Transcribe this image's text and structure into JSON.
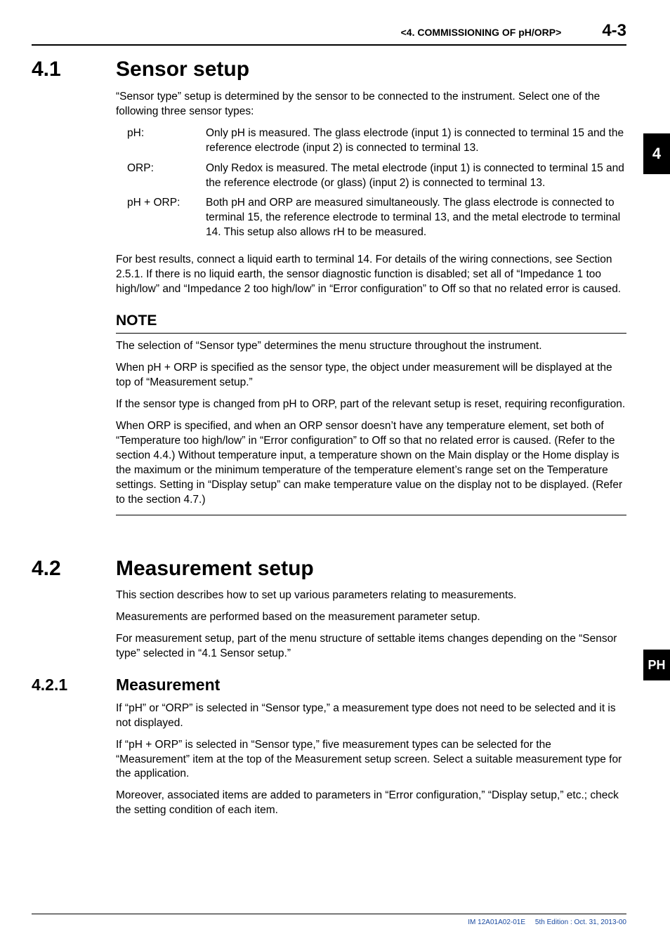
{
  "header": {
    "running": "<4.  COMMISSIONING OF pH/ORP>",
    "pagenum": "4-3"
  },
  "tabs": {
    "num": "4",
    "ph": "PH"
  },
  "s41": {
    "num": "4.1",
    "title": "Sensor setup",
    "intro": "“Sensor type” setup is determined by the sensor to be connected to the instrument. Select one of the following three sensor types:",
    "defs": {
      "k1": "pH:",
      "v1": "Only pH is measured. The glass electrode (input 1) is connected to terminal 15 and the reference electrode (input 2) is connected to terminal 13.",
      "k2": "ORP:",
      "v2": "Only Redox is measured. The metal electrode (input 1) is connected to terminal 15 and the reference electrode (or glass) (input 2) is connected to terminal 13.",
      "k3": "pH + ORP:",
      "v3": "Both pH and ORP are measured simultaneously. The glass electrode is connected to terminal 15, the reference electrode to terminal 13, and the metal electrode to terminal 14. This setup also allows rH to be measured."
    },
    "para2": "For best results, connect a liquid earth to terminal 14. For details of the wiring connections, see Section 2.5.1. If there is no liquid earth, the sensor diagnostic function is disabled; set all of “Impedance 1 too high/low” and “Impedance 2 too high/low” in “Error configuration” to Off so that no related error is caused."
  },
  "note": {
    "title": "NOTE",
    "p1": "The selection of “Sensor type” determines the menu structure throughout the instrument.",
    "p2": "When pH + ORP is specified as the sensor type, the object under measurement will be displayed at the top of “Measurement setup.”",
    "p3": "If the sensor type is changed from pH to ORP, part of the relevant setup is reset, requiring reconfiguration.",
    "p4": "When ORP is specified, and when an ORP sensor doesn’t have any temperature element, set both of “Temperature too high/low” in “Error configuration” to Off so that no related error is caused. (Refer to the section 4.4.) Without temperature input, a temperature shown on the Main display or the Home display is the maximum or the minimum temperature of the temperature element’s range set on the Temperature settings. Setting in “Display setup” can make temperature value on the display not to be displayed. (Refer to the section 4.7.)"
  },
  "s42": {
    "num": "4.2",
    "title": "Measurement setup",
    "p1": "This section describes how to set up various parameters relating to measurements.",
    "p2": "Measurements are performed based on the measurement parameter setup.",
    "p3": "For measurement setup, part of the menu structure of settable items changes depending on the “Sensor type” selected in “4.1 Sensor setup.”"
  },
  "s421": {
    "num": "4.2.1",
    "title": "Measurement",
    "p1": "If “pH” or “ORP” is selected in “Sensor type,” a measurement type does not need to be selected and it is not displayed.",
    "p2": "If “pH + ORP” is selected in “Sensor type,” five measurement types can be selected for the “Measurement” item at the top of the Measurement setup screen. Select a suitable measurement type for the application.",
    "p3": "Moreover, associated items are added to parameters in “Error configuration,” “Display setup,” etc.; check the setting condition of each item."
  },
  "footer": {
    "doc": "IM 12A01A02-01E",
    "ed": "5th Edition : Oct. 31, 2013-00"
  }
}
